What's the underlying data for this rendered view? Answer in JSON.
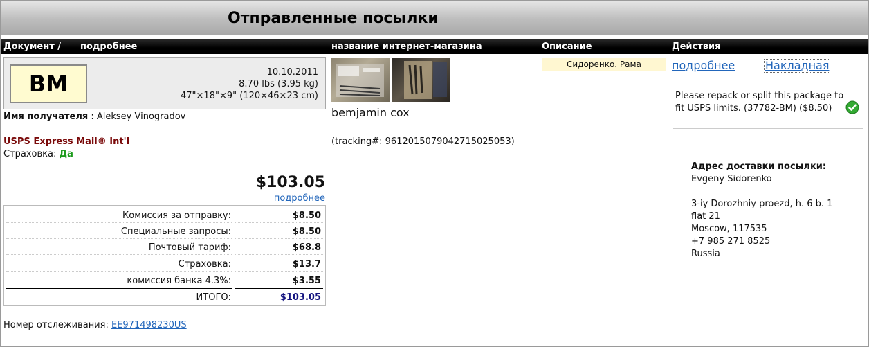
{
  "page_title": "Отправленные посылки",
  "columns": {
    "document": "Документ /",
    "document_more": "подробнее",
    "shop": "название интернет-магазина",
    "description": "Описание",
    "actions": "Действия"
  },
  "package": {
    "code": "BM",
    "date": "10.10.2011",
    "weight": "8.70 lbs (3.95 kg)",
    "dimensions": "47\"×18\"×9\" (120×46×23 cm)"
  },
  "recipient": {
    "label": "Имя получателя",
    "name": ": Aleksey Vinogradov"
  },
  "shipping": {
    "service": "USPS Express Mail® Int'l",
    "insurance_label": "Страховка:",
    "insurance_value": "Да"
  },
  "totals": {
    "amount": "$103.05",
    "more_link": "подробнее"
  },
  "fees": [
    {
      "label": "Комиссия за отправку:",
      "value": "$8.50"
    },
    {
      "label": "Специальные запросы:",
      "value": "$8.50"
    },
    {
      "label": "Почтовый тариф:",
      "value": "$68.8"
    },
    {
      "label": "Страховка:",
      "value": "$13.7"
    },
    {
      "label": "комиссия банка 4.3%:",
      "value": "$3.55"
    },
    {
      "label": "ИТОГО:",
      "value": "$103.05"
    }
  ],
  "tracking": {
    "label": "Номер отслеживания:",
    "number": "EE971498230US"
  },
  "shop": {
    "name": "bemjamin cox",
    "tracking": "(tracking#: 9612015079042715025053)"
  },
  "description": {
    "text": "Сидоренко. Рама"
  },
  "actions": {
    "more": "подробнее",
    "invoice": "Накладная"
  },
  "notice": {
    "text": "Please repack or split this package to fit USPS limits. (37782-BM) ($8.50)",
    "status_icon": "check-icon",
    "status_color": "#33aa33"
  },
  "address": {
    "title": "Адрес доставки посылки:",
    "name": "Evgeny Sidorenko",
    "line1": "3-iy Dorozhniy proezd, h. 6 b. 1",
    "line2": "flat 21",
    "city": "Moscow, 117535",
    "phone": "+7 985 271 8525",
    "country": "Russia"
  }
}
